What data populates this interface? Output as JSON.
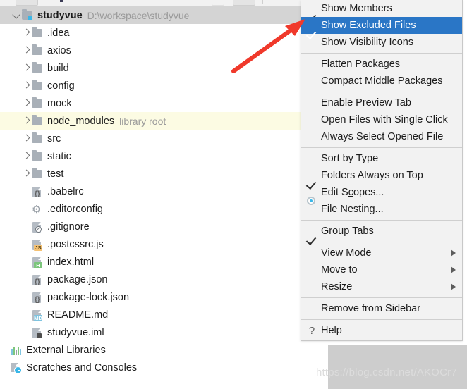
{
  "toolbar": {
    "label": "project-toolbar"
  },
  "tree": {
    "root": {
      "name": "studyvue",
      "path": "D:\\workspace\\studyvue",
      "expanded_icon": "chevron-down-icon"
    },
    "items": [
      {
        "label": ".idea",
        "sublabel": "",
        "type": "folder",
        "arrow": "right",
        "indent": 1,
        "state": "normal"
      },
      {
        "label": "axios",
        "sublabel": "",
        "type": "folder",
        "arrow": "right",
        "indent": 1,
        "state": "normal"
      },
      {
        "label": "build",
        "sublabel": "",
        "type": "folder",
        "arrow": "right",
        "indent": 1,
        "state": "normal"
      },
      {
        "label": "config",
        "sublabel": "",
        "type": "folder",
        "arrow": "right",
        "indent": 1,
        "state": "normal"
      },
      {
        "label": "mock",
        "sublabel": "",
        "type": "folder",
        "arrow": "right",
        "indent": 1,
        "state": "normal"
      },
      {
        "label": "node_modules",
        "sublabel": "library root",
        "type": "folder",
        "arrow": "right",
        "indent": 1,
        "state": "highlight"
      },
      {
        "label": "src",
        "sublabel": "",
        "type": "folder",
        "arrow": "right",
        "indent": 1,
        "state": "normal"
      },
      {
        "label": "static",
        "sublabel": "",
        "type": "folder",
        "arrow": "right",
        "indent": 1,
        "state": "normal"
      },
      {
        "label": "test",
        "sublabel": "",
        "type": "folder",
        "arrow": "right",
        "indent": 1,
        "state": "normal"
      },
      {
        "label": ".babelrc",
        "sublabel": "",
        "type": "file-json",
        "arrow": "none",
        "indent": 1,
        "state": "normal"
      },
      {
        "label": ".editorconfig",
        "sublabel": "",
        "type": "file-gear",
        "arrow": "none",
        "indent": 1,
        "state": "normal"
      },
      {
        "label": ".gitignore",
        "sublabel": "",
        "type": "file-ignore",
        "arrow": "none",
        "indent": 1,
        "state": "normal"
      },
      {
        "label": ".postcssrc.js",
        "sublabel": "",
        "type": "file-js",
        "arrow": "none",
        "indent": 1,
        "state": "normal"
      },
      {
        "label": "index.html",
        "sublabel": "",
        "type": "file-html",
        "arrow": "none",
        "indent": 1,
        "state": "normal"
      },
      {
        "label": "package.json",
        "sublabel": "",
        "type": "file-json",
        "arrow": "none",
        "indent": 1,
        "state": "normal"
      },
      {
        "label": "package-lock.json",
        "sublabel": "",
        "type": "file-json",
        "arrow": "none",
        "indent": 1,
        "state": "normal"
      },
      {
        "label": "README.md",
        "sublabel": "",
        "type": "file-md",
        "arrow": "none",
        "indent": 1,
        "state": "normal"
      },
      {
        "label": "studyvue.iml",
        "sublabel": "",
        "type": "file-iml",
        "arrow": "none",
        "indent": 1,
        "state": "normal"
      },
      {
        "label": "External Libraries",
        "sublabel": "",
        "type": "libraries",
        "arrow": "none",
        "indent": 0,
        "state": "normal"
      },
      {
        "label": "Scratches and Consoles",
        "sublabel": "",
        "type": "scratches",
        "arrow": "none",
        "indent": 0,
        "state": "normal"
      }
    ]
  },
  "menu": {
    "items": [
      {
        "label": "Show Members",
        "mark": "check",
        "selected": false,
        "submenu": false,
        "separator_after": false
      },
      {
        "label": "Show Excluded Files",
        "mark": "check",
        "selected": true,
        "submenu": false,
        "separator_after": false
      },
      {
        "label": "Show Visibility Icons",
        "mark": "none",
        "selected": false,
        "submenu": false,
        "separator_after": true
      },
      {
        "label": "Flatten Packages",
        "mark": "none",
        "selected": false,
        "submenu": false,
        "separator_after": false
      },
      {
        "label": "Compact Middle Packages",
        "mark": "none",
        "selected": false,
        "submenu": false,
        "separator_after": true
      },
      {
        "label": "Enable Preview Tab",
        "mark": "none",
        "selected": false,
        "submenu": false,
        "separator_after": false
      },
      {
        "label": "Open Files with Single Click",
        "mark": "none",
        "selected": false,
        "submenu": false,
        "separator_after": false
      },
      {
        "label": "Always Select Opened File",
        "mark": "none",
        "selected": false,
        "submenu": false,
        "separator_after": true
      },
      {
        "label": "Sort by Type",
        "mark": "none",
        "selected": false,
        "submenu": false,
        "separator_after": false
      },
      {
        "label": "Folders Always on Top",
        "mark": "check",
        "selected": false,
        "submenu": false,
        "separator_after": false
      },
      {
        "label": "Edit Scopes...",
        "mark": "radio",
        "selected": false,
        "submenu": false,
        "separator_after": false,
        "mnemonic_index": 6
      },
      {
        "label": "File Nesting...",
        "mark": "none",
        "selected": false,
        "submenu": false,
        "separator_after": true
      },
      {
        "label": "Group Tabs",
        "mark": "check",
        "selected": false,
        "submenu": false,
        "separator_after": true
      },
      {
        "label": "View Mode",
        "mark": "none",
        "selected": false,
        "submenu": true,
        "separator_after": false
      },
      {
        "label": "Move to",
        "mark": "none",
        "selected": false,
        "submenu": true,
        "separator_after": false
      },
      {
        "label": "Resize",
        "mark": "none",
        "selected": false,
        "submenu": true,
        "separator_after": true
      },
      {
        "label": "Remove from Sidebar",
        "mark": "none",
        "selected": false,
        "submenu": false,
        "separator_after": true
      },
      {
        "label": "Help",
        "mark": "question",
        "selected": false,
        "submenu": false,
        "separator_after": false
      }
    ]
  },
  "annotation": {
    "arrow_color": "#f0392b",
    "arrow_name": "red-pointer-arrow"
  },
  "watermark": {
    "text": "https://blog.csdn.net/AKOCr7"
  },
  "colors": {
    "selection_blue": "#2a76c6",
    "row_selected_gray": "#d4d4d4",
    "row_highlight_yellow": "#fcfbe3",
    "menu_bg": "#f2f2f2",
    "folder_gray": "#a9b0b8",
    "accent_cyan": "#3ab7e8"
  }
}
